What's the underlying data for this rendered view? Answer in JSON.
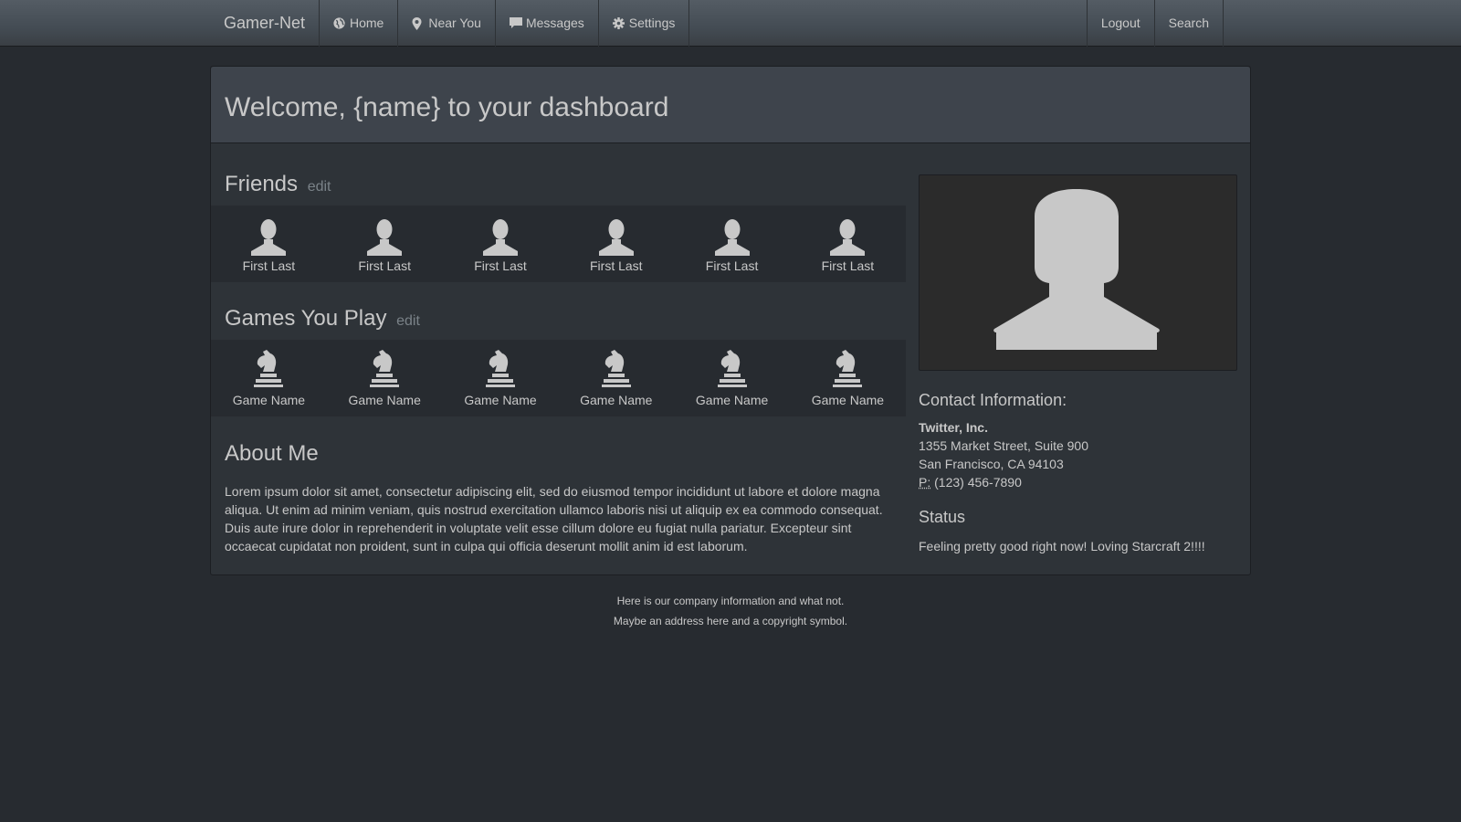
{
  "navbar": {
    "brand": "Gamer-Net",
    "left_items": [
      {
        "label": "Home",
        "icon": "globe-icon"
      },
      {
        "label": "Near You",
        "icon": "map-marker-icon"
      },
      {
        "label": "Messages",
        "icon": "comment-icon"
      },
      {
        "label": "Settings",
        "icon": "gear-icon"
      }
    ],
    "right_items": [
      {
        "label": "Logout"
      },
      {
        "label": "Search"
      }
    ]
  },
  "dashboard": {
    "title": "Welcome, {name} to your dashboard"
  },
  "friends": {
    "heading": "Friends",
    "edit_label": "edit",
    "items": [
      {
        "name": "First Last",
        "icon": "user-icon"
      },
      {
        "name": "First Last",
        "icon": "user-icon"
      },
      {
        "name": "First Last",
        "icon": "user-icon"
      },
      {
        "name": "First Last",
        "icon": "user-icon"
      },
      {
        "name": "First Last",
        "icon": "user-icon"
      },
      {
        "name": "First Last",
        "icon": "user-icon"
      }
    ]
  },
  "games": {
    "heading": "Games You Play",
    "edit_label": "edit",
    "items": [
      {
        "name": "Game Name",
        "icon": "chess-knight-icon"
      },
      {
        "name": "Game Name",
        "icon": "chess-knight-icon"
      },
      {
        "name": "Game Name",
        "icon": "chess-knight-icon"
      },
      {
        "name": "Game Name",
        "icon": "chess-knight-icon"
      },
      {
        "name": "Game Name",
        "icon": "chess-knight-icon"
      },
      {
        "name": "Game Name",
        "icon": "chess-knight-icon"
      }
    ]
  },
  "about": {
    "heading": "About Me",
    "text": "Lorem ipsum dolor sit amet, consectetur adipiscing elit, sed do eiusmod tempor incididunt ut labore et dolore magna aliqua. Ut enim ad minim veniam, quis nostrud exercitation ullamco laboris nisi ut aliquip ex ea commodo consequat. Duis aute irure dolor in reprehenderit in voluptate velit esse cillum dolore eu fugiat nulla pariatur. Excepteur sint occaecat cupidatat non proident, sunt in culpa qui officia deserunt mollit anim id est laborum."
  },
  "profile": {
    "avatar_icon": "user-silhouette-icon"
  },
  "contact": {
    "heading": "Contact Information:",
    "company": "Twitter, Inc.",
    "street": "1355 Market Street, Suite 900",
    "city": "San Francisco, CA 94103",
    "phone_label": "P:",
    "phone": "(123) 456-7890"
  },
  "status": {
    "heading": "Status",
    "text": "Feeling pretty good right now! Loving Starcraft 2!!!!"
  },
  "footer": {
    "line1": "Here is our company information and what not.",
    "line2": "Maybe an address here and a copyright symbol."
  },
  "colors": {
    "background": "#272b30",
    "panel": "#2e3338",
    "panel_header": "#3e444c",
    "text": "#c8c8c8",
    "muted": "#7a8288",
    "icon": "#c8c8c8"
  }
}
